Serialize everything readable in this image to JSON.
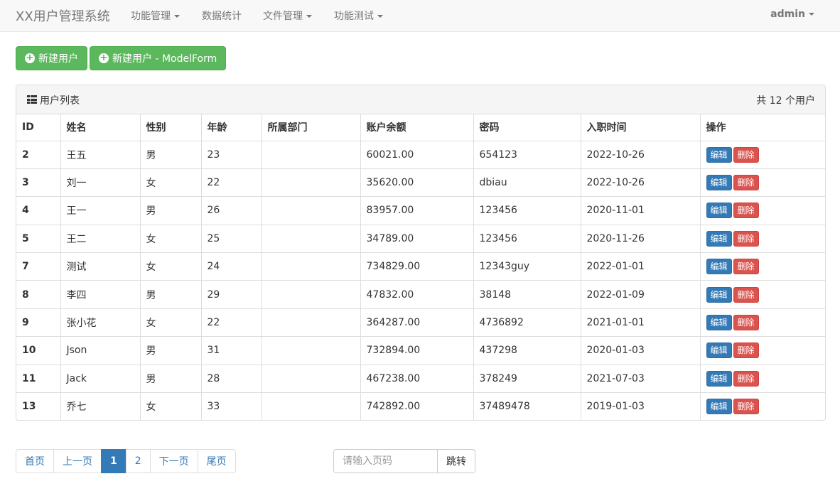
{
  "navbar": {
    "brand": "XX用户管理系统",
    "items": [
      {
        "label": "功能管理",
        "dropdown": true
      },
      {
        "label": "数据统计",
        "dropdown": false
      },
      {
        "label": "文件管理",
        "dropdown": true
      },
      {
        "label": "功能测试",
        "dropdown": true
      }
    ],
    "user": "admin"
  },
  "actions": {
    "new_user": "新建用户",
    "new_user_modelform": "新建用户 - ModelForm"
  },
  "panel": {
    "title": "用户列表",
    "count": "共 12 个用户"
  },
  "table": {
    "headers": [
      "ID",
      "姓名",
      "性别",
      "年龄",
      "所属部门",
      "账户余额",
      "密码",
      "入职时间",
      "操作"
    ],
    "rows": [
      [
        "2",
        "王五",
        "男",
        "23",
        "",
        "60021.00",
        "654123",
        "2022-10-26"
      ],
      [
        "3",
        "刘一",
        "女",
        "22",
        "",
        "35620.00",
        "dbiau",
        "2022-10-26"
      ],
      [
        "4",
        "王一",
        "男",
        "26",
        "",
        "83957.00",
        "123456",
        "2020-11-01"
      ],
      [
        "5",
        "王二",
        "女",
        "25",
        "",
        "34789.00",
        "123456",
        "2020-11-26"
      ],
      [
        "7",
        "测试",
        "女",
        "24",
        "",
        "734829.00",
        "12343guy",
        "2022-01-01"
      ],
      [
        "8",
        "李四",
        "男",
        "29",
        "",
        "47832.00",
        "38148",
        "2022-01-09"
      ],
      [
        "9",
        "张小花",
        "女",
        "22",
        "",
        "364287.00",
        "4736892",
        "2021-01-01"
      ],
      [
        "10",
        "Json",
        "男",
        "31",
        "",
        "732894.00",
        "437298",
        "2020-01-03"
      ],
      [
        "11",
        "Jack",
        "男",
        "28",
        "",
        "467238.00",
        "378249",
        "2021-07-03"
      ],
      [
        "13",
        "乔七",
        "女",
        "33",
        "",
        "742892.00",
        "37489478",
        "2019-01-03"
      ]
    ],
    "edit_label": "编辑",
    "delete_label": "删除"
  },
  "pagination": {
    "first": "首页",
    "prev": "上一页",
    "pages": [
      "1",
      "2"
    ],
    "current": "1",
    "next": "下一页",
    "last": "尾页"
  },
  "jump": {
    "placeholder": "请输入页码",
    "button": "跳转"
  },
  "colors": {
    "success": "#5cb85c",
    "primary": "#337ab7",
    "danger": "#d9534f"
  }
}
